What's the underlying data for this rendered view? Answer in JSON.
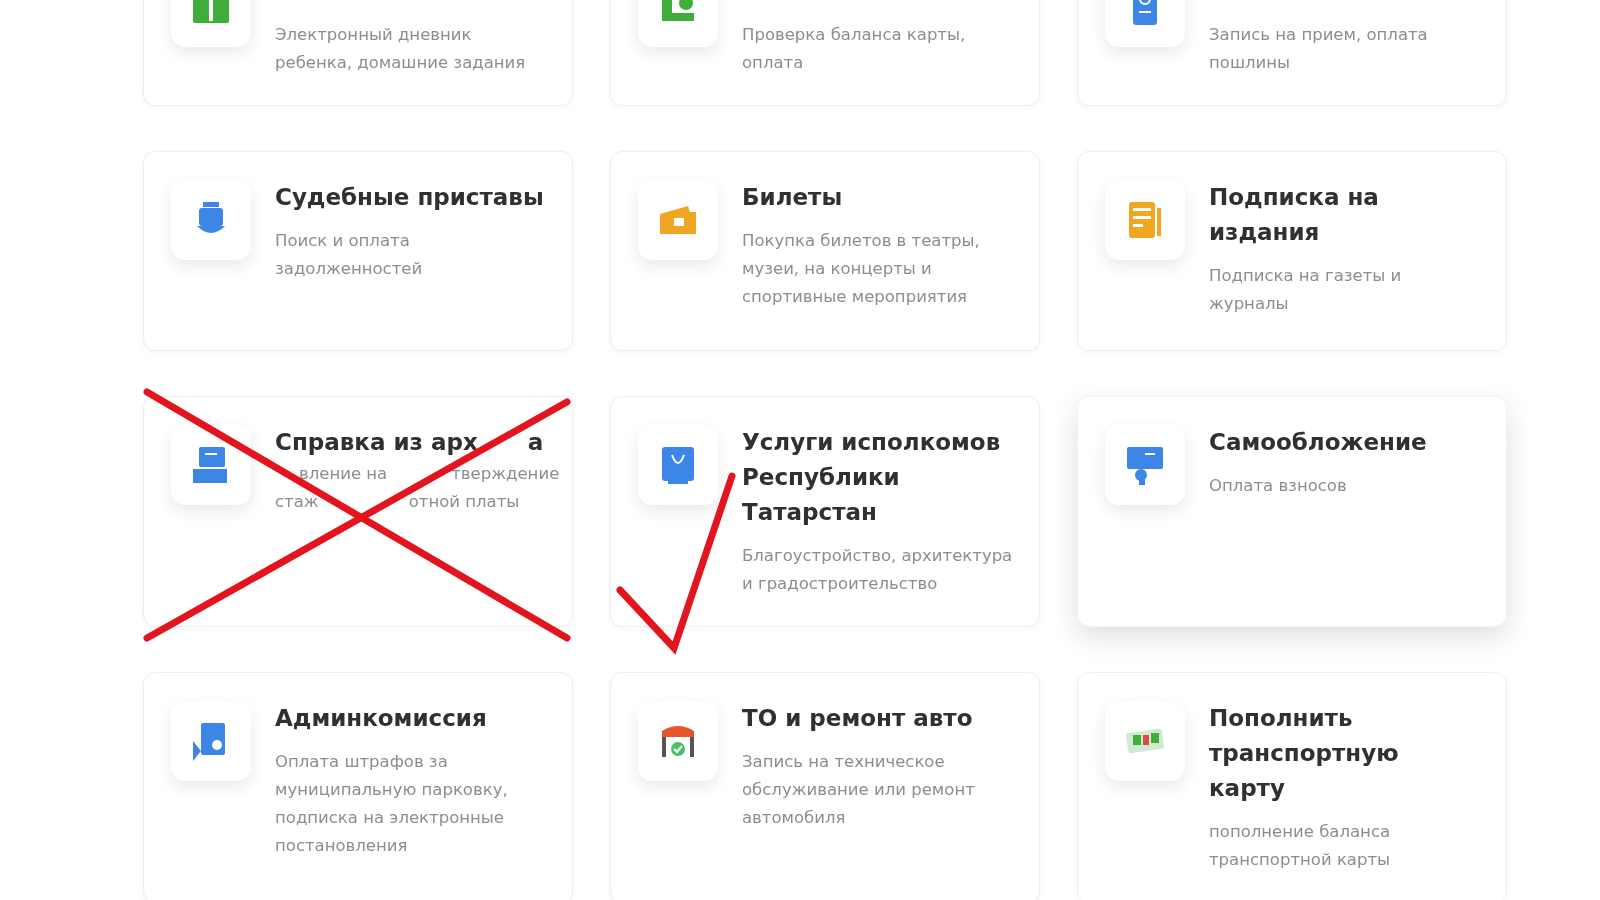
{
  "cards": [
    {
      "description": "Электронный дневник ребенка, домашние задания",
      "hovered": false
    },
    {
      "description": "Проверка баланса карты, оплата",
      "hovered": false
    },
    {
      "description": "Запись на прием, оплата пошлины",
      "hovered": false
    },
    {
      "title": "Судебные приставы",
      "description": "Поиск и оплата задолженностей",
      "hovered": false
    },
    {
      "title": "Билеты",
      "description": "Покупка билетов в театры, музеи, на концерты и спортивные мероприятия",
      "hovered": false
    },
    {
      "title": "Подписка на издания",
      "description": "Подписка на газеты и журналы",
      "hovered": false
    },
    {
      "title_fragments": [
        "Справка из арх",
        "а"
      ],
      "description_lines": [
        [
          "вление на",
          "тверждение"
        ],
        [
          "стаж",
          "отной платы"
        ]
      ],
      "hovered": false,
      "crossed_out": true,
      "check_marked": false
    },
    {
      "title": "Услуги исполкомов Республики Татарстан",
      "description": "Благоустройство, архитектура и градостроительство",
      "hovered": false,
      "crossed_out": false,
      "check_marked": true
    },
    {
      "title": "Самообложение",
      "description": "Оплата взносов",
      "hovered": true
    },
    {
      "title": "Админкомиссия",
      "description": "Оплата штрафов за муниципальную парковку, подписка на электронные постановления",
      "hovered": false
    },
    {
      "title": "ТО и ремонт авто",
      "description": "Запись на техническое обслуживание или ремонт автомобиля",
      "hovered": false
    },
    {
      "title": "Пополнить транспортную карту",
      "description": "пополнение баланса транспортной карты",
      "hovered": false
    }
  ]
}
